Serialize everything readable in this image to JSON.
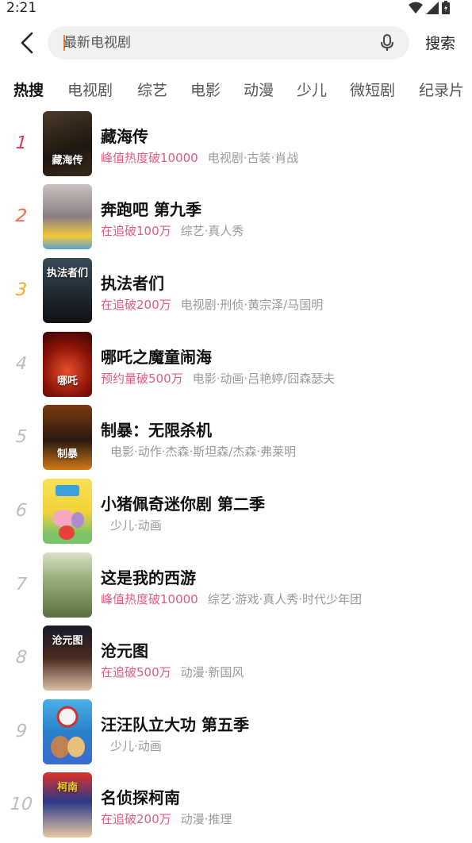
{
  "status_bar": {
    "time": "2:21"
  },
  "search": {
    "placeholder": "最新电视剧",
    "button_label": "搜索"
  },
  "tabs": [
    "热搜",
    "电视剧",
    "综艺",
    "电影",
    "动漫",
    "少儿",
    "微短剧",
    "纪录片"
  ],
  "active_tab": "热搜",
  "colors": {
    "accent_pink": "#e35b7d",
    "rank1": "#e8334a",
    "rank2": "#f26a3d",
    "rank3": "#f5a623",
    "muted": "#999999"
  },
  "list": [
    {
      "rank": "1",
      "title": "藏海传",
      "heat": "峰值热度破10000",
      "tags": "电视剧·古装·肖战",
      "poster_text": "藏海传"
    },
    {
      "rank": "2",
      "title": "奔跑吧 第九季",
      "heat": "在追破100万",
      "tags": "综艺·真人秀",
      "poster_text": ""
    },
    {
      "rank": "3",
      "title": "执法者们",
      "heat": "在追破200万",
      "tags": "电视剧·刑侦·黄宗泽/马国明",
      "poster_text": "执法者们"
    },
    {
      "rank": "4",
      "title": "哪吒之魔童闹海",
      "heat": "预约量破500万",
      "tags": "电影·动画·吕艳婷/囧森瑟夫",
      "poster_text": "哪吒"
    },
    {
      "rank": "5",
      "title": "制暴：无限杀机",
      "heat": "",
      "tags": "电影·动作·杰森·斯坦森/杰森·弗莱明",
      "poster_text": "制暴"
    },
    {
      "rank": "6",
      "title": "小猪佩奇迷你剧 第二季",
      "heat": "",
      "tags": "少儿·动画",
      "poster_text": ""
    },
    {
      "rank": "7",
      "title": "这是我的西游",
      "heat": "峰值热度破10000",
      "tags": "综艺·游戏·真人秀·时代少年团",
      "poster_text": ""
    },
    {
      "rank": "8",
      "title": "沧元图",
      "heat": "在追破500万",
      "tags": "动漫·新国风",
      "poster_text": "沧元图"
    },
    {
      "rank": "9",
      "title": "汪汪队立大功 第五季",
      "heat": "",
      "tags": "少儿·动画",
      "poster_text": ""
    },
    {
      "rank": "10",
      "title": "名侦探柯南",
      "heat": "在追破200万",
      "tags": "动漫·推理",
      "poster_text": "柯南"
    }
  ]
}
